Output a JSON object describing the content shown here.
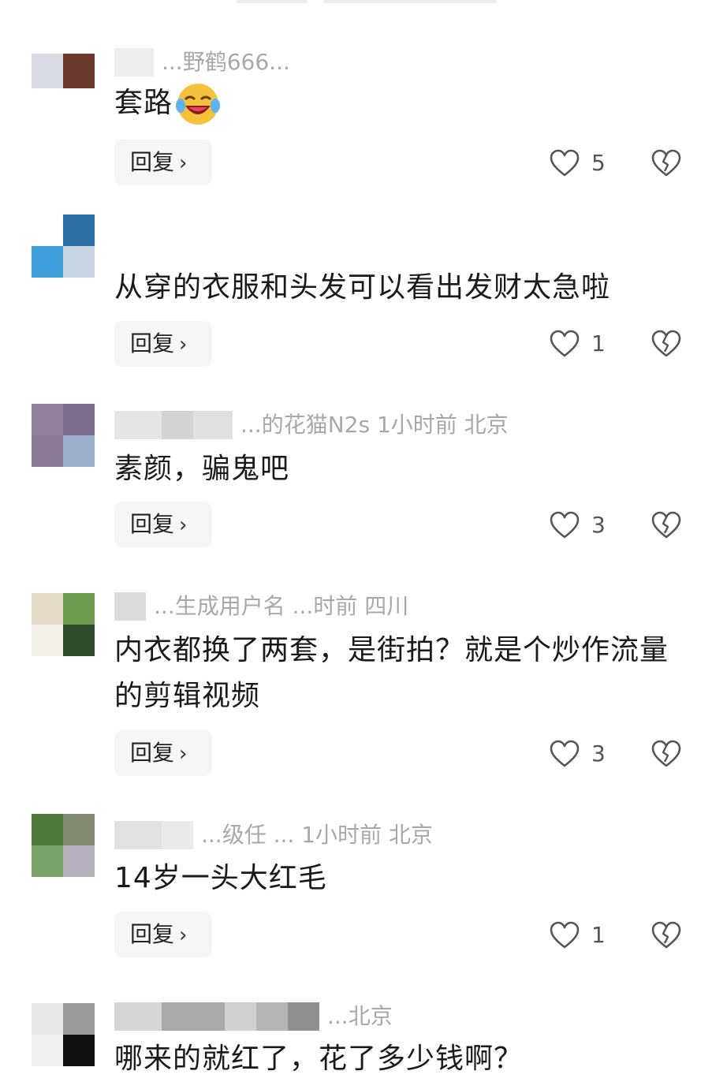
{
  "reply_label": "回复",
  "comments": [
    {
      "meta": "...野鹤666...",
      "text": "套路",
      "emoji": "joy-emoji",
      "likes": "5"
    },
    {
      "meta": "",
      "text": "从穿的衣服和头发可以看出发财太急啦",
      "likes": "1"
    },
    {
      "meta": "...的花猫N2s  1小时前  北京",
      "text": "素颜，骗鬼吧",
      "likes": "3"
    },
    {
      "meta": "...生成用户名  ...时前  四川",
      "text": "内衣都换了两套，是街拍？就是个炒作流量的剪辑视频",
      "likes": "3"
    },
    {
      "meta": "...级任 ... 1小时前  北京",
      "text": "14岁一头大红毛",
      "likes": "1"
    },
    {
      "meta": "...北京",
      "text": "哪来的就红了，花了多少钱啊？",
      "likes": ""
    }
  ],
  "colors": {
    "meta_gray": "#a8a8a8",
    "reply_bg": "#f6f6f6",
    "icon_stroke": "#555555"
  },
  "icons": {
    "like": "heart-outline-icon",
    "dislike": "broken-heart-icon",
    "reply_chevron": "chevron-right-icon"
  }
}
